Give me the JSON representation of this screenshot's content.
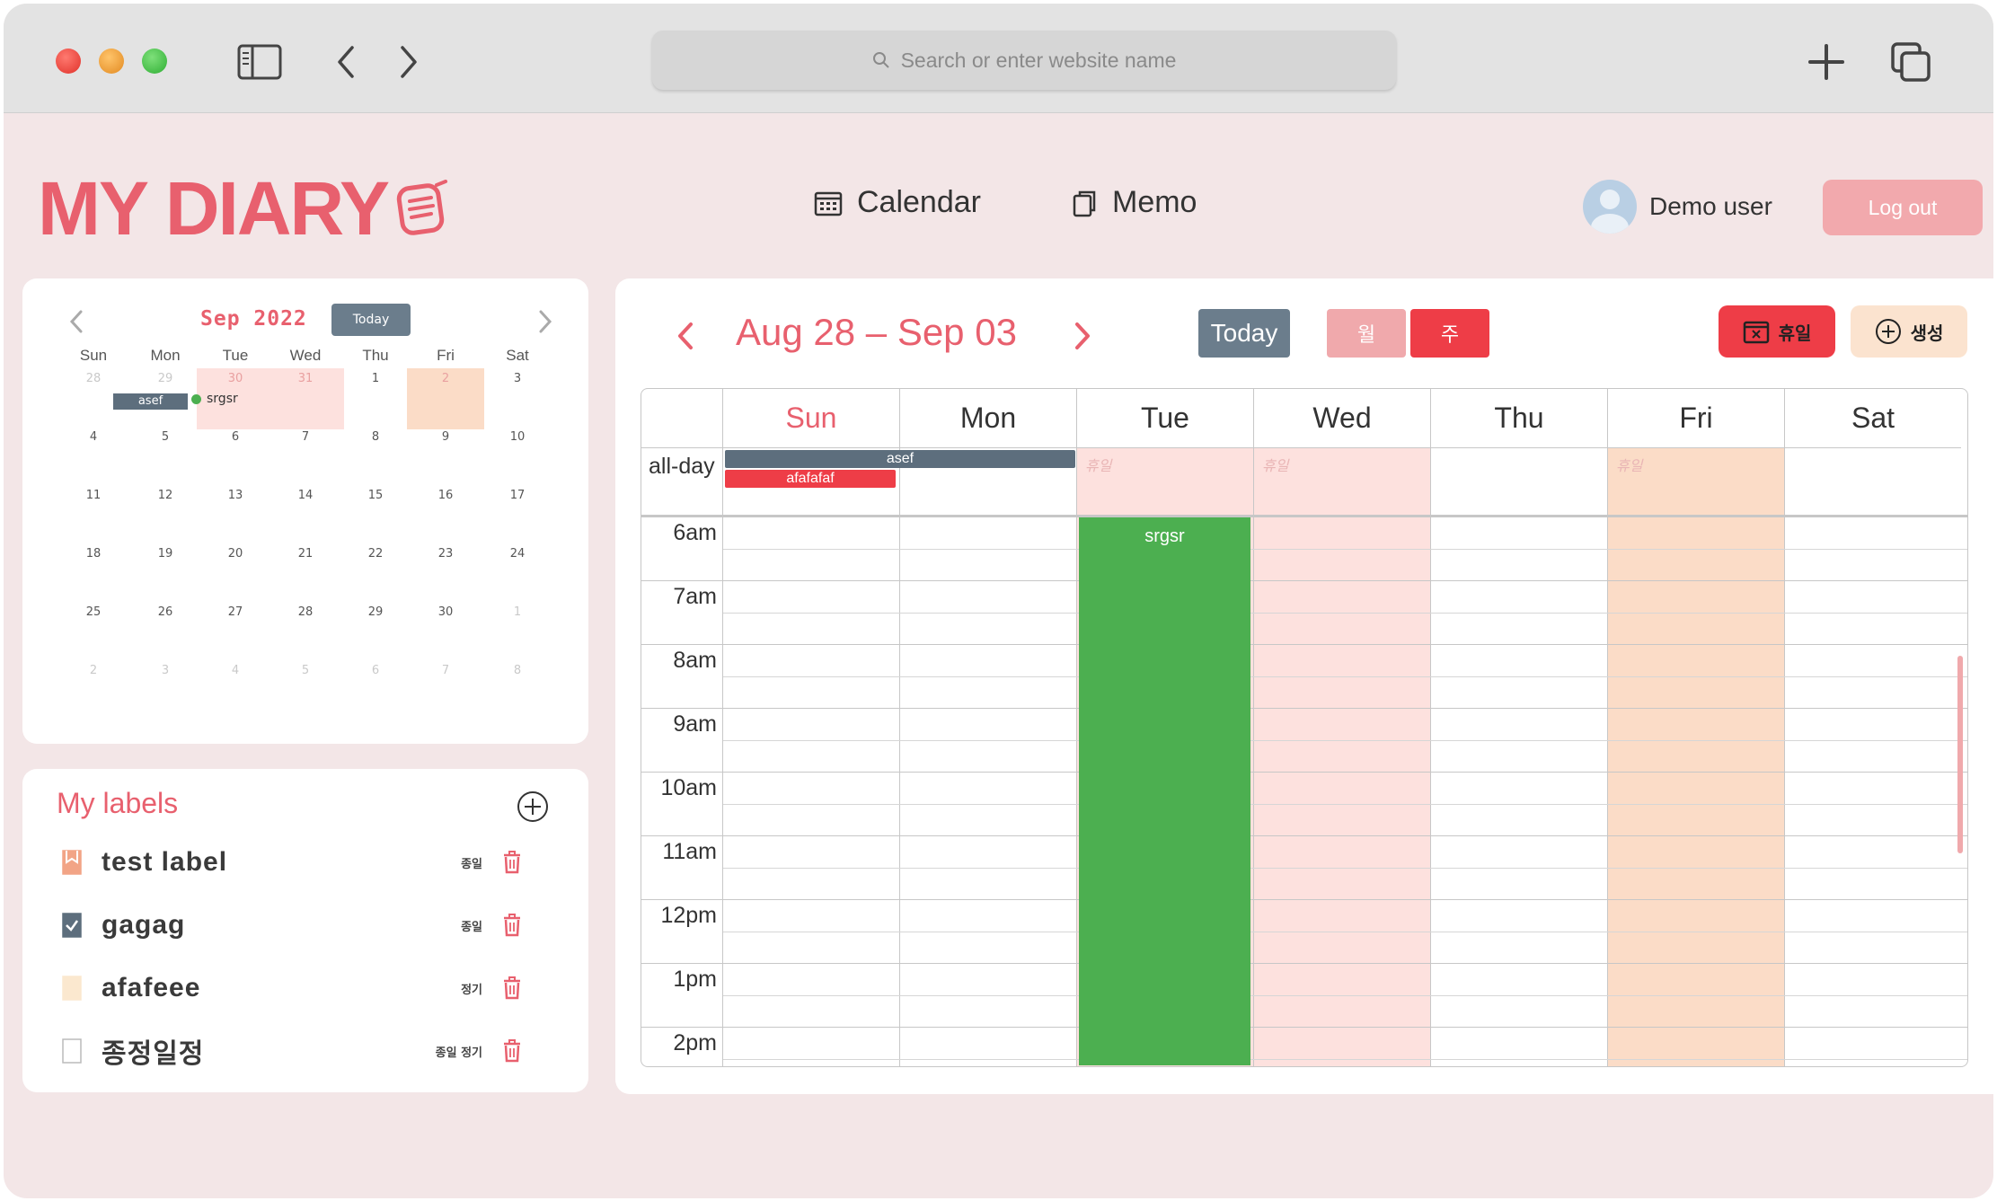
{
  "browser": {
    "search_placeholder": "Search or enter website name"
  },
  "header": {
    "logo": "MY DIARY",
    "nav": [
      {
        "label": "Calendar"
      },
      {
        "label": "Memo"
      }
    ],
    "user_name": "Demo user",
    "logout_label": "Log out"
  },
  "mini_calendar": {
    "title": "Sep 2022",
    "today_label": "Today",
    "weekdays": [
      "Sun",
      "Mon",
      "Tue",
      "Wed",
      "Thu",
      "Fri",
      "Sat"
    ],
    "weeks": [
      [
        "28",
        "29",
        "30",
        "31",
        "1",
        "2",
        "3"
      ],
      [
        "4",
        "5",
        "6",
        "7",
        "8",
        "9",
        "10"
      ],
      [
        "11",
        "12",
        "13",
        "14",
        "15",
        "16",
        "17"
      ],
      [
        "18",
        "19",
        "20",
        "21",
        "22",
        "23",
        "24"
      ],
      [
        "25",
        "26",
        "27",
        "28",
        "29",
        "30",
        "1"
      ],
      [
        "2",
        "3",
        "4",
        "5",
        "6",
        "7",
        "8"
      ]
    ],
    "events": [
      {
        "label": "asef"
      },
      {
        "label": "srgsr"
      }
    ]
  },
  "labels": {
    "title": "My labels",
    "items": [
      {
        "name": "test label",
        "tag": "종일",
        "color": "#f2a486"
      },
      {
        "name": "gagag",
        "tag": "종일",
        "color": "#5d6e7d"
      },
      {
        "name": "afafeee",
        "tag": "정기",
        "color": "#fbe8cf"
      },
      {
        "name": "종정일정",
        "tag": "종일 정기",
        "color": "#ffffff"
      }
    ]
  },
  "week_view": {
    "title": "Aug 28 – Sep 03",
    "today_label": "Today",
    "month_label": "월",
    "week_label": "주",
    "holiday_label": "휴일",
    "create_label": "생성",
    "days": [
      "Sun",
      "Mon",
      "Tue",
      "Wed",
      "Thu",
      "Fri",
      "Sat"
    ],
    "allday_label": "all-day",
    "holiday_marks": [
      "휴일",
      "휴일",
      "휴일"
    ],
    "times": [
      "6am",
      "7am",
      "8am",
      "9am",
      "10am",
      "11am",
      "12pm",
      "1pm",
      "2pm"
    ],
    "allday_events": [
      {
        "label": "asef",
        "color": "#5d6e7d"
      },
      {
        "label": "afafafaf",
        "color": "#ee3d47"
      }
    ],
    "timed_events": [
      {
        "label": "srgsr",
        "color": "#4caf50"
      }
    ]
  },
  "colors": {
    "accent": "#e8606e",
    "primary_red": "#ee3d47",
    "slate": "#6b7d8c",
    "holiday_pink": "#fde1de",
    "holiday_peach": "#fbdcc7",
    "event_green": "#4caf50"
  }
}
